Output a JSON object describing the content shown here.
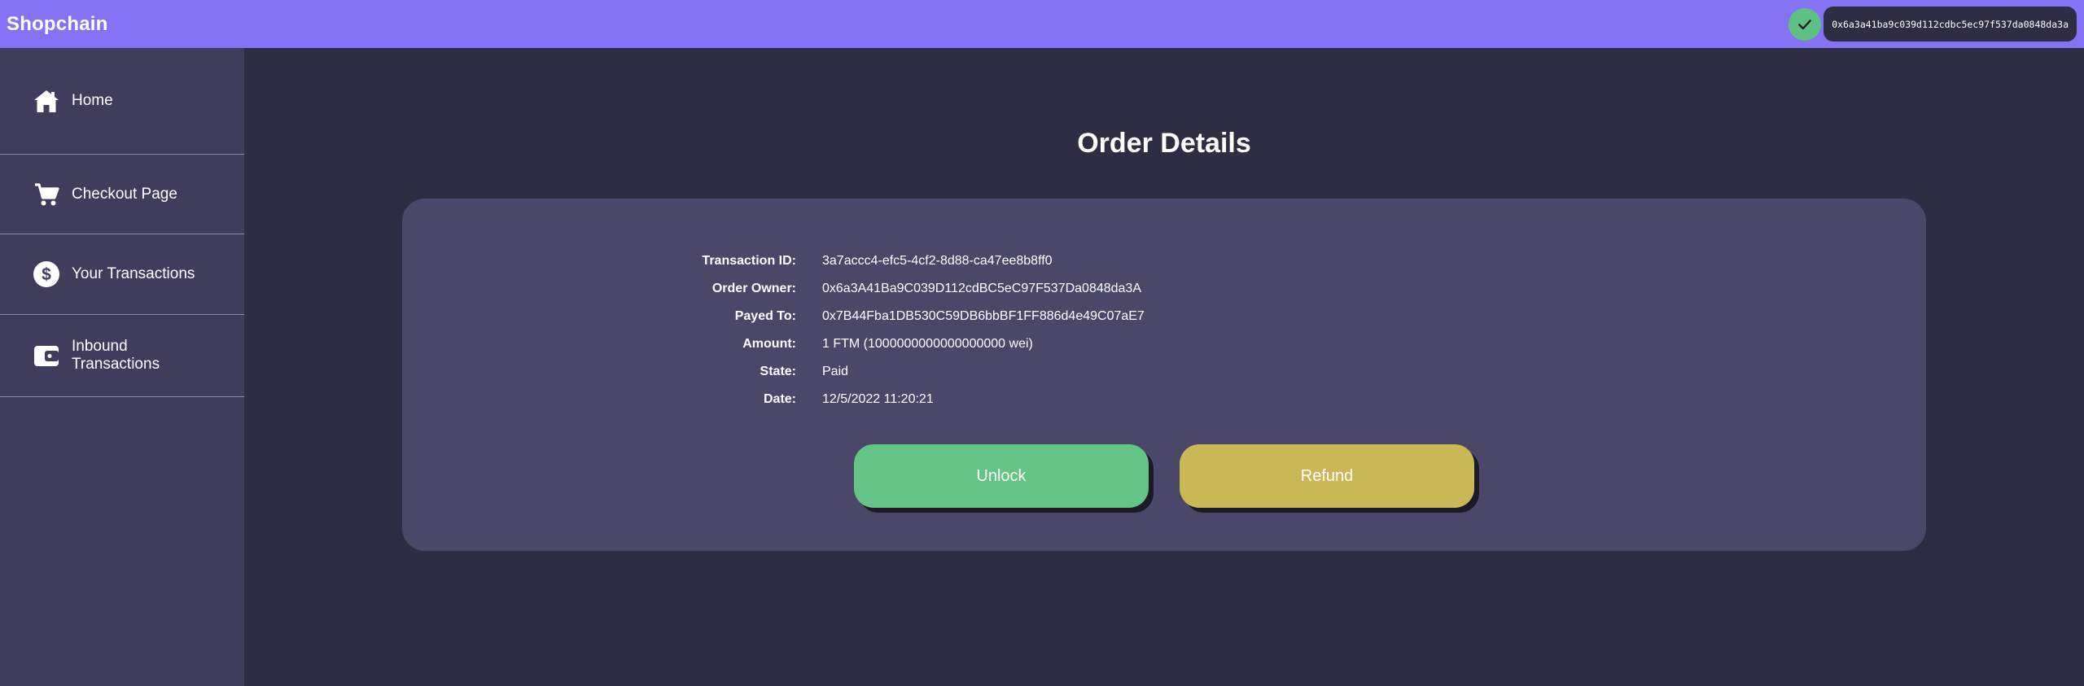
{
  "app": {
    "name": "Shopchain"
  },
  "wallet": {
    "connected_icon": "check-icon",
    "address": "0x6a3a41ba9c039d112cdbc5ec97f537da0848da3a",
    "status_color": "#5fc083"
  },
  "sidebar": {
    "items": [
      {
        "label": "Home",
        "icon": "home-icon"
      },
      {
        "label": "Checkout Page",
        "icon": "cart-icon"
      },
      {
        "label": "Your Transactions",
        "icon": "dollar-icon"
      },
      {
        "label": "Inbound Transactions",
        "icon": "wallet-icon"
      }
    ]
  },
  "main": {
    "title": "Order Details",
    "details": [
      {
        "key": "Transaction ID:",
        "value": "3a7accc4-efc5-4cf2-8d88-ca47ee8b8ff0"
      },
      {
        "key": "Order Owner:",
        "value": "0x6a3A41Ba9C039D112cdBC5eC97F537Da0848da3A"
      },
      {
        "key": "Payed To:",
        "value": "0x7B44Fba1DB530C59DB6bbBF1FF886d4e49C07aE7"
      },
      {
        "key": "Amount:",
        "value": "1 FTM (1000000000000000000 wei)"
      },
      {
        "key": "State:",
        "value": "Paid"
      },
      {
        "key": "Date:",
        "value": "12/5/2022 11:20:21"
      }
    ],
    "buttons": {
      "unlock": "Unlock",
      "refund": "Refund"
    }
  },
  "colors": {
    "topbar": "#8473f5",
    "background": "#2f2d44",
    "sidebar": "#403c5c",
    "card": "#4a4769",
    "unlock": "#65c485",
    "refund": "#cab856"
  }
}
